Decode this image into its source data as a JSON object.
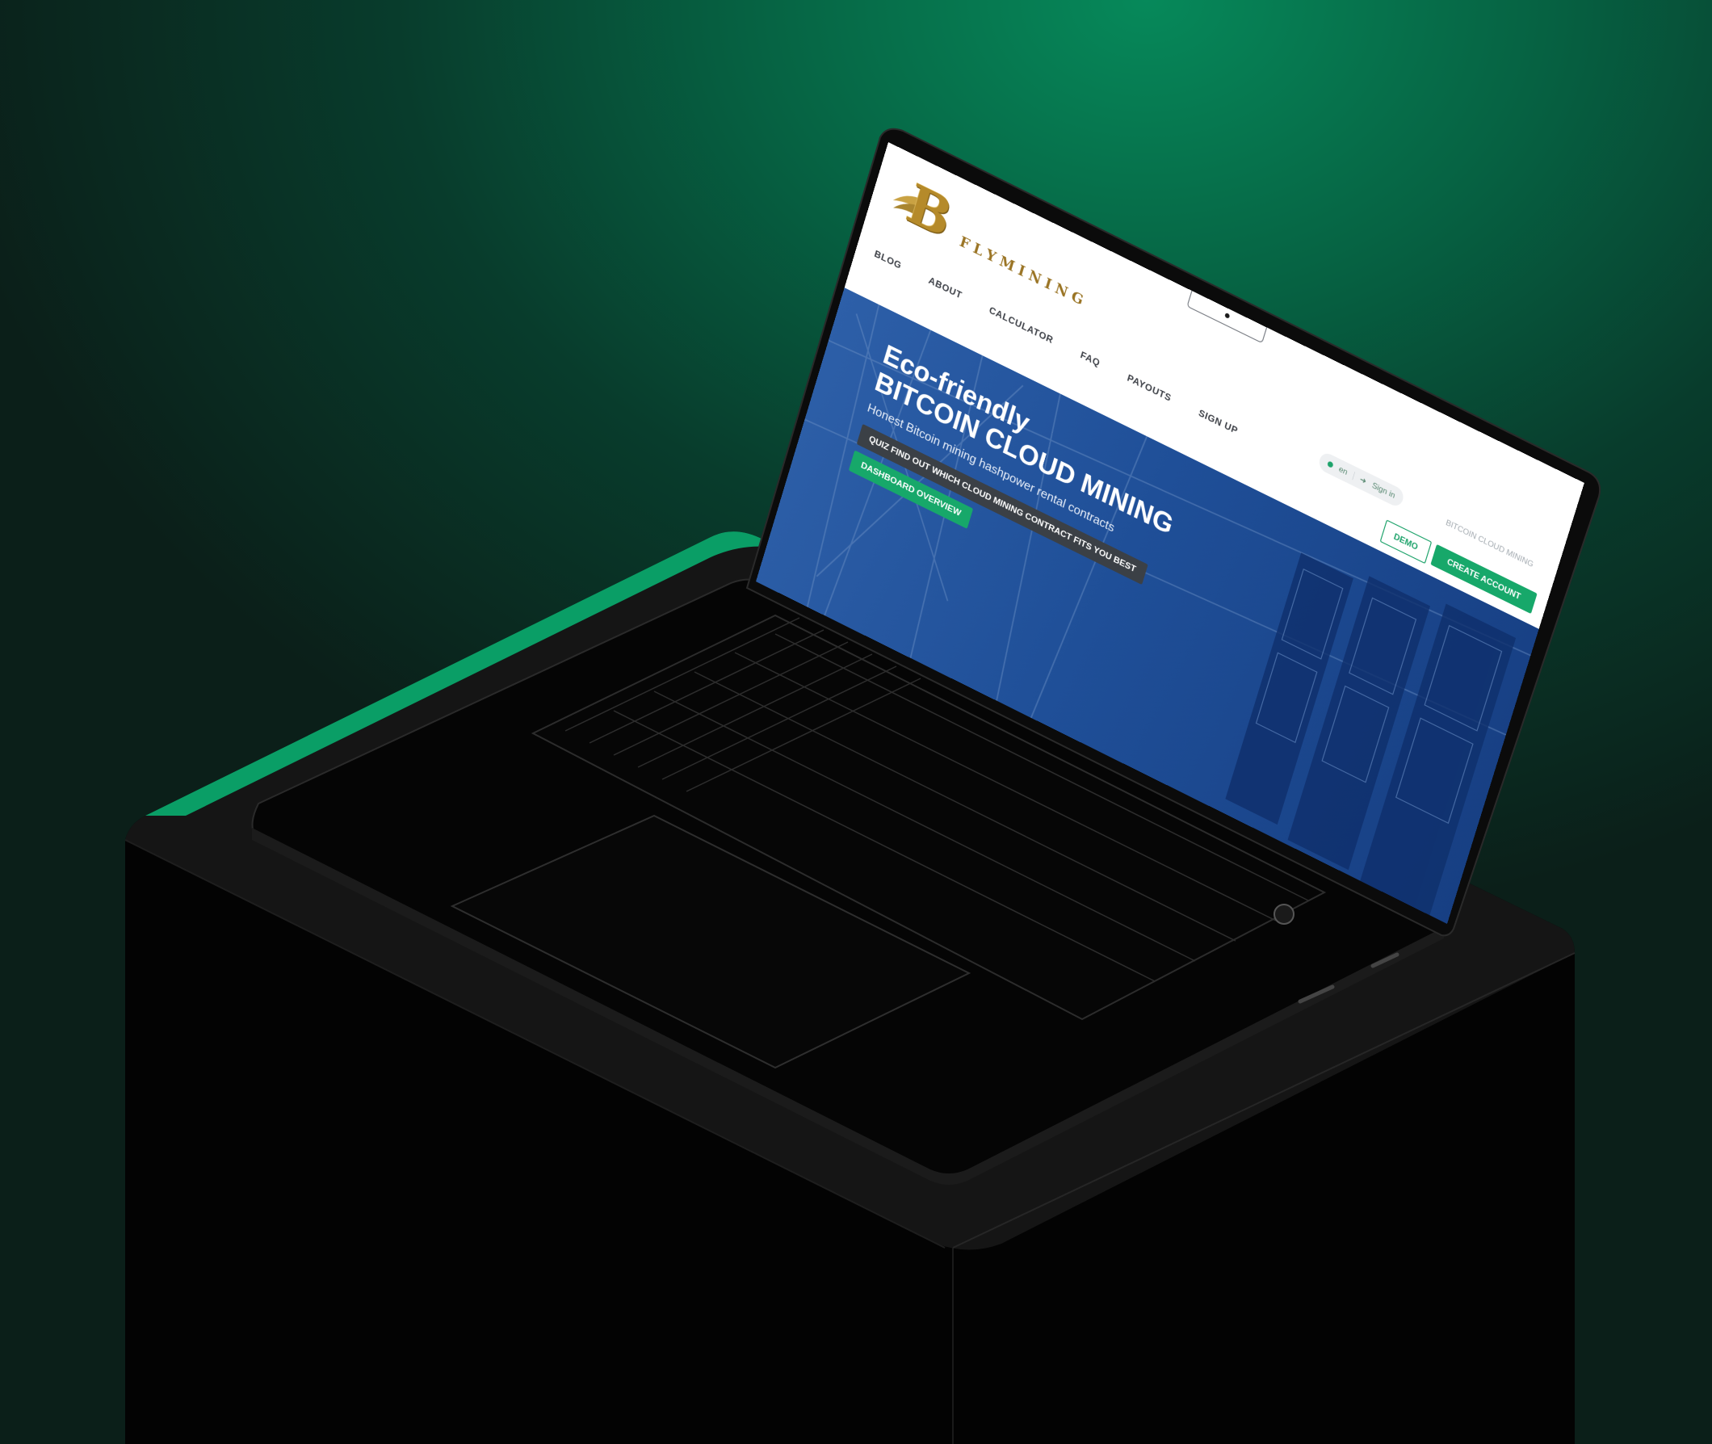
{
  "colors": {
    "background_green": "#066343",
    "accent_green": "#17a86a",
    "hero_blue": "#1f4f98",
    "logo_gold": "#b58a2a",
    "pedestal": "#030303"
  },
  "site": {
    "logo_icon": "bitcoin-wing-logo-icon",
    "logo_letter": "B",
    "brand": "FLYMINING",
    "nav": [
      "BLOG",
      "ABOUT",
      "CALCULATOR",
      "FAQ",
      "PAYOUTS",
      "SIGN UP"
    ],
    "lang": "en",
    "signin": "Sign in",
    "top_label": "BITCOIN CLOUD MINING",
    "demo": "DEMO",
    "create_account": "CREATE ACCOUNT"
  },
  "hero": {
    "line1": "Eco-friendly",
    "line2": "BITCOIN CLOUD MINING",
    "subtitle": "Honest Bitcoin mining hashpower rental contracts",
    "quiz_button": "QUIZ FIND OUT WHICH CLOUD MINING CONTRACT FITS YOU BEST",
    "dashboard_button": "DASHBOARD OVERVIEW"
  }
}
